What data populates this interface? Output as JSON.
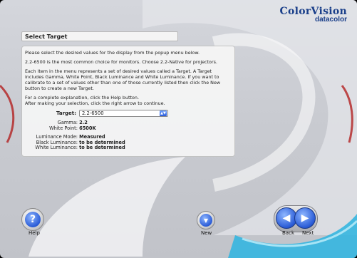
{
  "logo": {
    "brand": "ColorVision",
    "sub": "datacolor"
  },
  "header": {
    "title": "Select Target"
  },
  "panel": {
    "para1": "Please select the desired values for the display from the popup menu below.",
    "para2": "2.2-6500 is the most common choice for monitors. Choose 2.2-Native for projectors.",
    "para3": "Each item in the menu represents a set of desired values called a Target. A Target includes Gamma, White Point, Black Luminance and White Luminance. If you want to calibrate to a set of values other than one of those currently listed then click the New button to create a new Target.",
    "para4a": "For a complete explanation, click the Help button.",
    "para4b": "After making your selection, click the right arrow to continue."
  },
  "target": {
    "label": "Target:",
    "value": "2.2-6500"
  },
  "details": {
    "gamma_label": "Gamma:",
    "gamma_value": "2.2",
    "whitepoint_label": "White Point:",
    "whitepoint_value": "6500K"
  },
  "luminance": {
    "mode_label": "Luminance Mode:",
    "mode_value": "Measured",
    "black_label": "Black Luminance:",
    "black_value": "to be determined",
    "white_label": "White Luminance:",
    "white_value": "to be determined"
  },
  "buttons": {
    "help": "Help",
    "new": "New",
    "back": "Back",
    "next": "Next"
  },
  "icons": {
    "help": "question-mark-icon",
    "new": "down-arrow-icon",
    "back": "left-arrow-icon",
    "next": "right-arrow-icon"
  },
  "colors": {
    "brand": "#1a3f8a",
    "accent_blue": "#2a5bd6",
    "accent_red": "#b32020",
    "swoosh": "#35b6e0"
  }
}
